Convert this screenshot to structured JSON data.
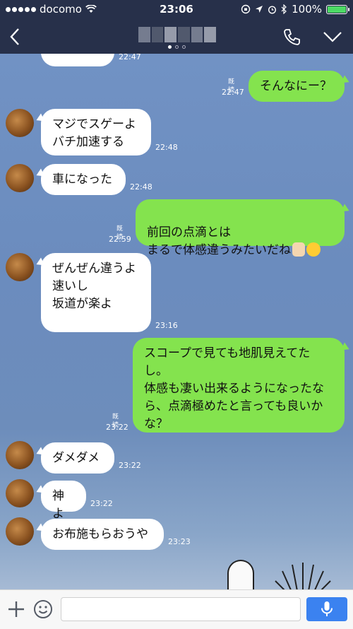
{
  "status": {
    "carrier": "docomo",
    "time": "23:06",
    "battery": "100%",
    "battery_level": 1.0
  },
  "nav": {
    "page_count": 3,
    "active_page": 1
  },
  "messages": [
    {
      "from": "them",
      "text": "",
      "time": "22:47"
    },
    {
      "from": "me",
      "text": "そんなにー？",
      "time": "22:47",
      "read": "既読"
    },
    {
      "from": "them",
      "text": "マジでスゲーよ\nバチ加速する",
      "time": "22:48"
    },
    {
      "from": "them",
      "text": "車になった",
      "time": "22:48"
    },
    {
      "from": "me",
      "text": "前回の点滴とは\nまるで体感違うみたいだね",
      "time": "22:59",
      "read": "既読"
    },
    {
      "from": "them",
      "text": "ぜんぜん違うよ\n速いし\n坂道が楽よ",
      "time": "23:16"
    },
    {
      "from": "me",
      "text": "スコープで見ても地肌見えてた\nし。\n体感も凄い出来るようになったな\nら、点滴極めたと言っても良いか\nな？",
      "time": "23:22",
      "read": "既読"
    },
    {
      "from": "them",
      "text": "ダメダメ",
      "time": "23:22"
    },
    {
      "from": "them",
      "text": "神よ",
      "time": "23:22"
    },
    {
      "from": "them",
      "text": "お布施もらおうや",
      "time": "23:23"
    }
  ],
  "input": {
    "placeholder": "",
    "value": ""
  },
  "colors": {
    "header": "#27304a",
    "my_bubble": "#84e34e",
    "their_bubble": "#ffffff",
    "mic_button": "#3b82f0"
  },
  "icons": {
    "back": "chevron-left-icon",
    "call": "phone-icon",
    "menu": "chevron-down-icon",
    "plus": "plus-icon",
    "emoji": "smiley-icon",
    "mic": "microphone-icon"
  }
}
